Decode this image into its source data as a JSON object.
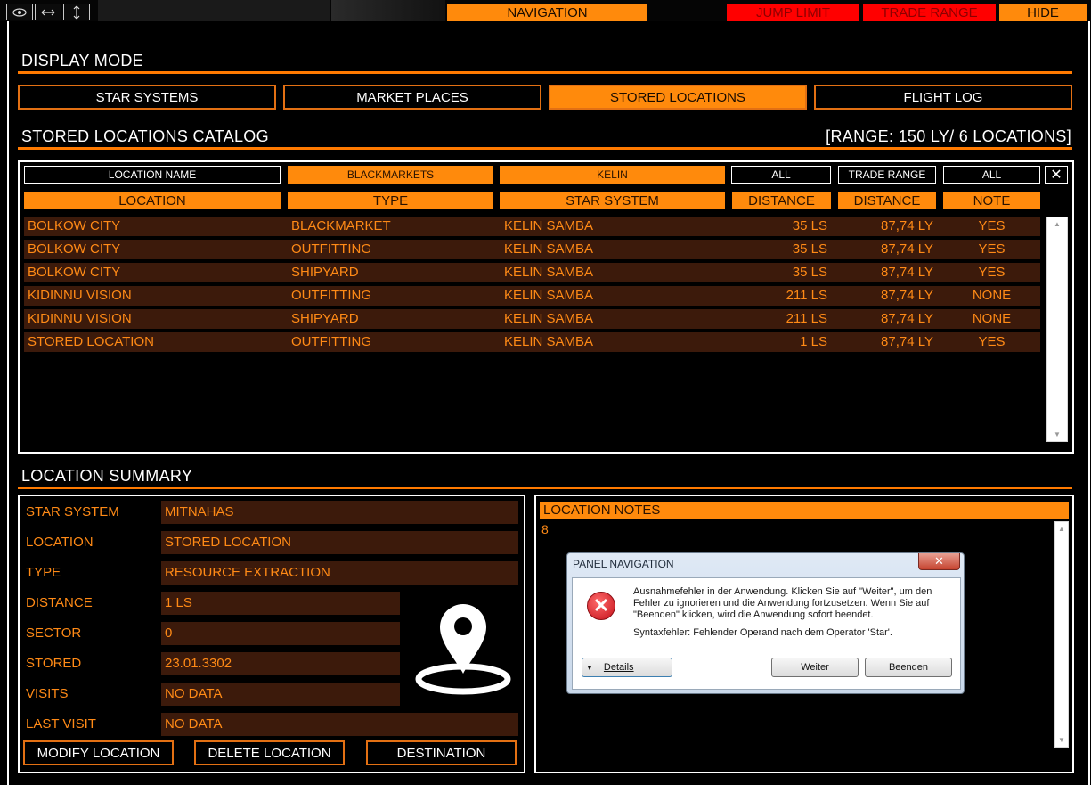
{
  "toolbar": {
    "icons": [
      "eye-icon",
      "resize-horizontal-icon",
      "resize-vertical-icon"
    ],
    "tabs": {
      "navigation": "NAVIGATION",
      "jump_limit": "JUMP LIMIT",
      "trade_range": "TRADE RANGE",
      "hide": "HIDE"
    }
  },
  "display_mode": {
    "title": "DISPLAY MODE",
    "buttons": [
      "STAR SYSTEMS",
      "MARKET PLACES",
      "STORED LOCATIONS",
      "FLIGHT LOG"
    ],
    "active": "STORED LOCATIONS"
  },
  "catalog": {
    "title": "STORED LOCATIONS CATALOG",
    "range_info": "[RANGE: 150 LY/ 6 LOCATIONS]",
    "filters": [
      "LOCATION NAME",
      "BLACKMARKETS",
      "KELIN",
      "ALL",
      "TRADE RANGE",
      "ALL"
    ],
    "clear_label": "✕",
    "columns": [
      "LOCATION",
      "TYPE",
      "STAR SYSTEM",
      "DISTANCE",
      "DISTANCE",
      "NOTE"
    ],
    "rows": [
      [
        "BOLKOW CITY",
        "BLACKMARKET",
        "KELIN SAMBA",
        "35 LS",
        "87,74 LY",
        "YES"
      ],
      [
        "BOLKOW CITY",
        "OUTFITTING",
        "KELIN SAMBA",
        "35 LS",
        "87,74 LY",
        "YES"
      ],
      [
        "BOLKOW CITY",
        "SHIPYARD",
        "KELIN SAMBA",
        "35 LS",
        "87,74 LY",
        "YES"
      ],
      [
        "KIDINNU VISION",
        "OUTFITTING",
        "KELIN SAMBA",
        "211 LS",
        "87,74 LY",
        "NONE"
      ],
      [
        "KIDINNU VISION",
        "SHIPYARD",
        "KELIN SAMBA",
        "211 LS",
        "87,74 LY",
        "NONE"
      ],
      [
        "STORED LOCATION",
        "OUTFITTING",
        "KELIN SAMBA",
        "1 LS",
        "87,74 LY",
        "YES"
      ]
    ]
  },
  "summary": {
    "title": "LOCATION SUMMARY",
    "fields": [
      {
        "label": "STAR SYSTEM",
        "value": "MITNAHAS"
      },
      {
        "label": "LOCATION",
        "value": "STORED LOCATION"
      },
      {
        "label": "TYPE",
        "value": "RESOURCE EXTRACTION"
      },
      {
        "label": "DISTANCE",
        "value": "1 LS"
      },
      {
        "label": "SECTOR",
        "value": "0"
      },
      {
        "label": "STORED",
        "value": "23.01.3302"
      },
      {
        "label": "VISITS",
        "value": "NO DATA"
      },
      {
        "label": "LAST VISIT",
        "value": "NO DATA"
      }
    ],
    "buttons": [
      "MODIFY LOCATION",
      "DELETE LOCATION",
      "DESTINATION"
    ]
  },
  "notes": {
    "title": "LOCATION NOTES",
    "text": "8"
  },
  "dialog": {
    "title": "PANEL NAVIGATION",
    "close": "✕",
    "message": "Ausnahmefehler in der Anwendung. Klicken Sie auf \"Weiter\", um den Fehler zu ignorieren und die Anwendung fortzusetzen. Wenn Sie auf \"Beenden\" klicken, wird die Anwendung sofort beendet.",
    "detail": "Syntaxfehler: Fehlender Operand nach dem Operator 'Star'.",
    "details_button": "Details",
    "continue_button": "Weiter",
    "quit_button": "Beenden"
  },
  "colors": {
    "accent": "#ff8a0c",
    "row_bg": "#3c1a0b",
    "warning_red": "#ff0000"
  }
}
